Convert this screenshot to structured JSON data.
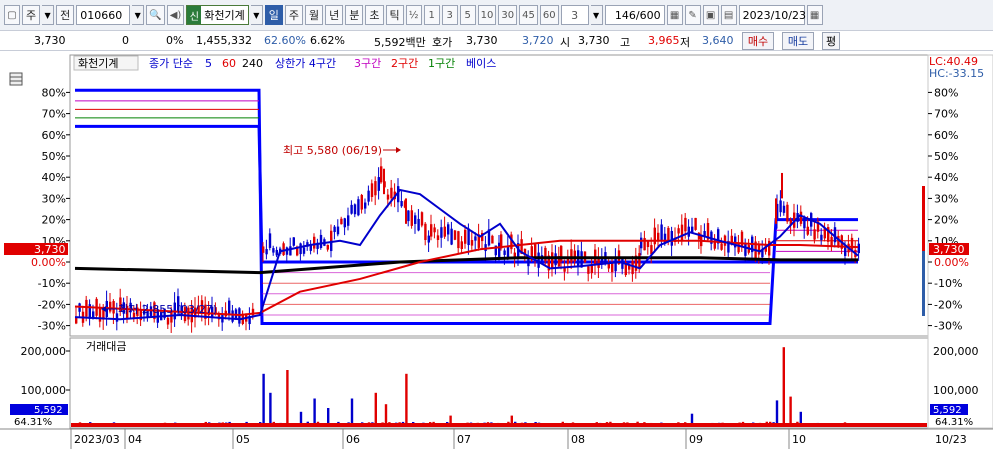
{
  "toolbar": {
    "market": "주",
    "prev_label": "전",
    "code": "010660",
    "search_icon": "magnifier-icon",
    "sound_icon": "speaker-icon",
    "stock_badge": "신",
    "stock_name": "화천기계",
    "period_tabs": [
      "일",
      "주",
      "월",
      "년",
      "분",
      "초",
      "틱"
    ],
    "active_period": "일",
    "fraction_label": "½",
    "interval_buttons": [
      "1",
      "3",
      "5",
      "10",
      "30",
      "45",
      "60"
    ],
    "interval_value": "3",
    "count_current": "146",
    "count_total": "/600",
    "date": "2023/10/23"
  },
  "info": {
    "price": "3,730",
    "change": "0",
    "change_pct": "0%",
    "volume": "1,455,332",
    "pct_a": "62.60%",
    "pct_b": "6.62%",
    "amount": "5,592백만",
    "hoga_label": "호가",
    "hoga_value": "3,730",
    "hoga_value2": "3,720",
    "open_label": "시",
    "open_value": "3,730",
    "high_label": "고",
    "high_value": "3,965",
    "low_label": "저",
    "low_value": "3,640",
    "buy_label": "매수",
    "sell_label": "매도",
    "eval_label": "평"
  },
  "price_chart": {
    "legend": {
      "name": "화천기계",
      "ma_label": "종가 단순",
      "ma5": "5",
      "ma60": "60",
      "ma240": "240",
      "upper": "상한가 4구간",
      "z3": "3구간",
      "z2": "2구간",
      "z1": "1구간",
      "base": "베이스"
    },
    "y_ticks_left": [
      "80%",
      "70%",
      "60%",
      "50%",
      "40%",
      "30%",
      "20%",
      "10%",
      "0.00%",
      "-10%",
      "-20%",
      "-30%"
    ],
    "y_ticks_right": [
      "80%",
      "70%",
      "60%",
      "50%",
      "40%",
      "30%",
      "20%",
      "10%",
      "0.00%",
      "-10%",
      "-20%",
      "-30%"
    ],
    "y_values": [
      80,
      70,
      60,
      50,
      40,
      30,
      20,
      10,
      0,
      -10,
      -20,
      -30
    ],
    "current_label": "3,730",
    "lc": "LC:40.49",
    "hc": "HC:-33.15",
    "high_annotation": "최고 5,580 (06/19)",
    "low_annotation": "최저 2,855 (03/27)",
    "colors": {
      "up": "#e00000",
      "down": "#0000cc",
      "ma5": "#0000cc",
      "ma60": "#e00000",
      "ma240": "#000000",
      "zone": "#0000ff"
    }
  },
  "volume_chart": {
    "title": "거래대금",
    "y_ticks": [
      "200,000",
      "100,000"
    ],
    "y_values": [
      200000,
      100000
    ],
    "current_value": "5,592",
    "current_pct": "64.31%"
  },
  "x_axis": {
    "labels": [
      "2023/03",
      "04",
      "05",
      "06",
      "07",
      "08",
      "09",
      "10"
    ],
    "end_label": "10/23"
  }
}
